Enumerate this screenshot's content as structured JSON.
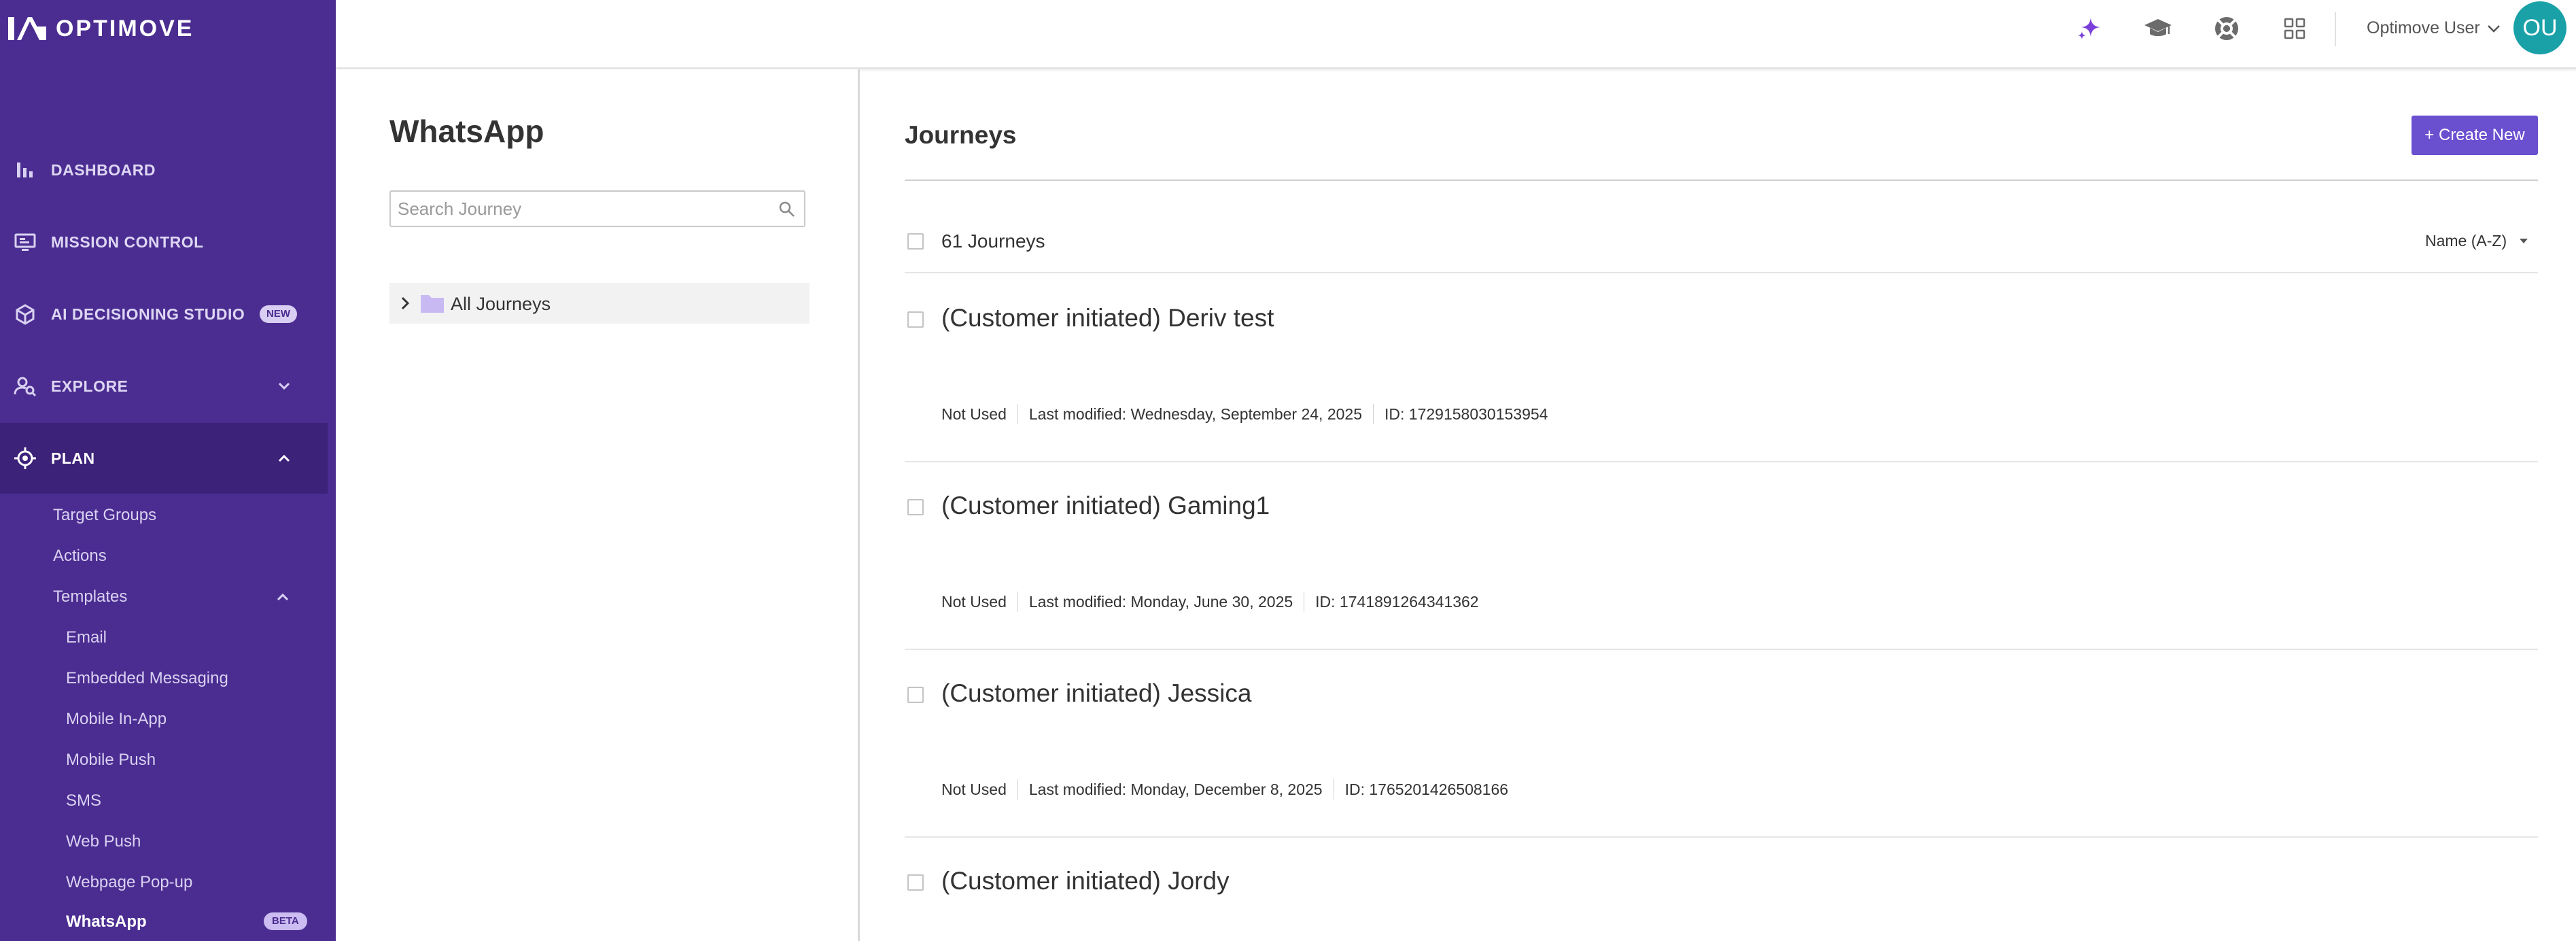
{
  "brand": {
    "name": "OPTIMOVE"
  },
  "sidebar": {
    "nav": [
      {
        "label": "DASHBOARD"
      },
      {
        "label": "MISSION CONTROL"
      },
      {
        "label": "AI DECISIONING STUDIO",
        "badge": "NEW"
      },
      {
        "label": "EXPLORE"
      },
      {
        "label": "PLAN"
      }
    ],
    "plan_items": [
      "Target Groups",
      "Actions",
      "Templates"
    ],
    "template_items": [
      "Email",
      "Embedded Messaging",
      "Mobile In-App",
      "Mobile Push",
      "SMS",
      "Web Push",
      "Webpage Pop-up",
      "WhatsApp"
    ],
    "whatsapp_badge": "BETA"
  },
  "topbar": {
    "user_name": "Optimove User",
    "avatar_initials": "OU",
    "icons": [
      "sparkle-icon",
      "graduation-cap-icon",
      "support-icon",
      "apps-grid-icon"
    ]
  },
  "left_panel": {
    "title": "WhatsApp",
    "search_placeholder": "Search Journey",
    "folder_label": "All Journeys"
  },
  "main": {
    "title": "Journeys",
    "create_label": "+ Create New",
    "count_label": "61 Journeys",
    "sort_label": "Name (A-Z)",
    "journeys": [
      {
        "name": "(Customer initiated) Deriv test",
        "status": "Not Used",
        "modified": "Last modified: Wednesday, September 24, 2025",
        "id": "ID: 1729158030153954"
      },
      {
        "name": "(Customer initiated) Gaming1",
        "status": "Not Used",
        "modified": "Last modified: Monday, June 30, 2025",
        "id": "ID: 1741891264341362"
      },
      {
        "name": "(Customer initiated) Jessica",
        "status": "Not Used",
        "modified": "Last modified: Monday, December 8, 2025",
        "id": "ID: 1765201426508166"
      },
      {
        "name": "(Customer initiated) Jordy"
      }
    ]
  },
  "colors": {
    "sidebar_bg": "#4b2d91",
    "sidebar_active": "#3d2279",
    "accent_button": "#6a4fcf",
    "avatar_bg": "#1aa1a8",
    "sparkle": "#7b3fd9"
  }
}
